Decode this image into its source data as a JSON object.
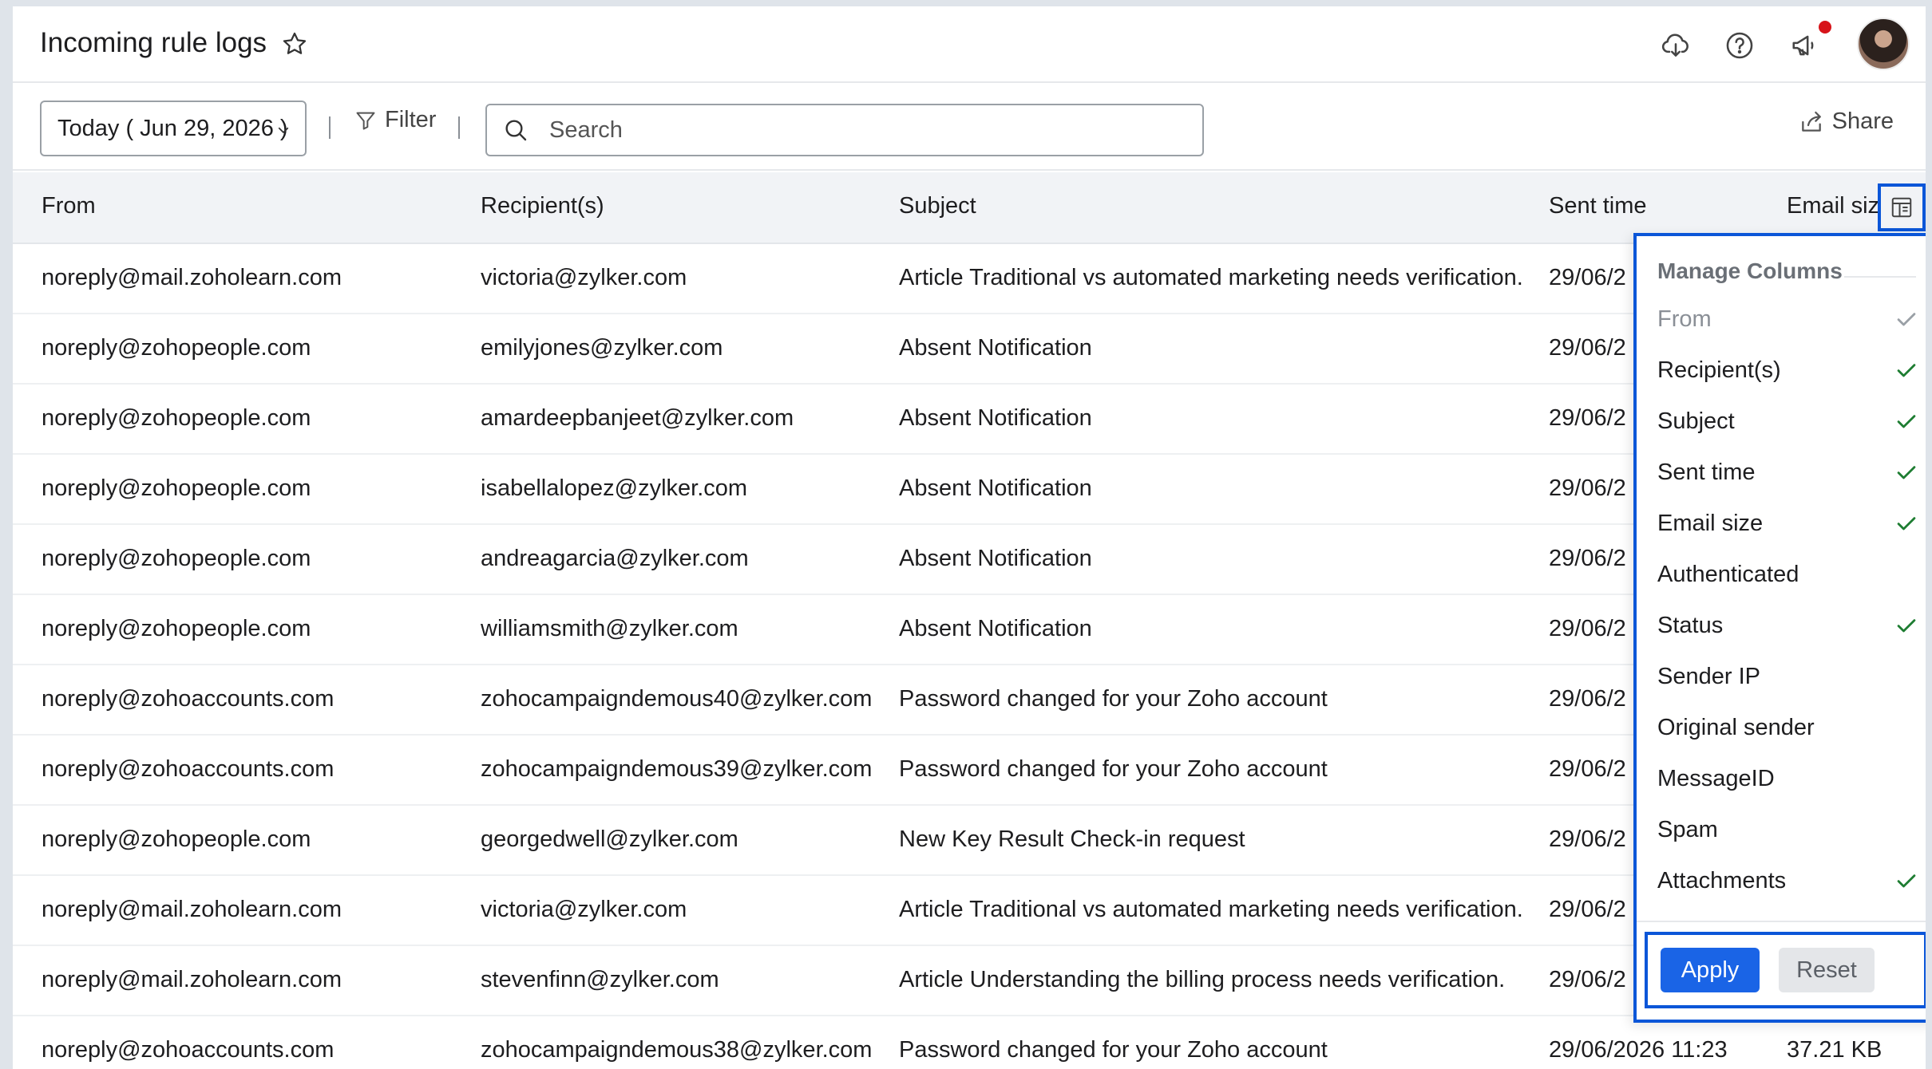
{
  "header": {
    "title": "Incoming rule logs",
    "icons": [
      "star-icon",
      "cloud-download-icon",
      "help-icon",
      "announcement-icon",
      "avatar"
    ]
  },
  "toolbar": {
    "date_label": "Today ( Jun 29, 2026 )",
    "filter_label": "Filter",
    "search_placeholder": "Search",
    "share_label": "Share"
  },
  "table": {
    "columns": [
      "From",
      "Recipient(s)",
      "Subject",
      "Sent time",
      "Email size"
    ],
    "rows": [
      {
        "from": "noreply@mail.zoholearn.com",
        "to": "victoria@zylker.com",
        "subject": "Article Traditional vs automated marketing needs verification.",
        "sent": "29/06/2",
        "size": ""
      },
      {
        "from": "noreply@zohopeople.com",
        "to": "emilyjones@zylker.com",
        "subject": "Absent Notification",
        "sent": "29/06/2",
        "size": ""
      },
      {
        "from": "noreply@zohopeople.com",
        "to": "amardeepbanjeet@zylker.com",
        "subject": "Absent Notification",
        "sent": "29/06/2",
        "size": ""
      },
      {
        "from": "noreply@zohopeople.com",
        "to": "isabellalopez@zylker.com",
        "subject": "Absent Notification",
        "sent": "29/06/2",
        "size": ""
      },
      {
        "from": "noreply@zohopeople.com",
        "to": "andreagarcia@zylker.com",
        "subject": "Absent Notification",
        "sent": "29/06/2",
        "size": ""
      },
      {
        "from": "noreply@zohopeople.com",
        "to": "williamsmith@zylker.com",
        "subject": "Absent Notification",
        "sent": "29/06/2",
        "size": ""
      },
      {
        "from": "noreply@zohoaccounts.com",
        "to": "zohocampaigndemous40@zylker.com",
        "subject": "Password changed for your Zoho account",
        "sent": "29/06/2",
        "size": ""
      },
      {
        "from": "noreply@zohoaccounts.com",
        "to": "zohocampaigndemous39@zylker.com",
        "subject": "Password changed for your Zoho account",
        "sent": "29/06/2",
        "size": ""
      },
      {
        "from": "noreply@zohopeople.com",
        "to": "georgedwell@zylker.com",
        "subject": "New Key Result Check-in request",
        "sent": "29/06/2",
        "size": ""
      },
      {
        "from": "noreply@mail.zoholearn.com",
        "to": "victoria@zylker.com",
        "subject": "Article Traditional vs automated marketing needs verification.",
        "sent": "29/06/2",
        "size": ""
      },
      {
        "from": "noreply@mail.zoholearn.com",
        "to": "stevenfinn@zylker.com",
        "subject": "Article Understanding the billing process needs verification.",
        "sent": "29/06/2",
        "size": ""
      },
      {
        "from": "noreply@zohoaccounts.com",
        "to": "zohocampaigndemous38@zylker.com",
        "subject": "Password changed for your Zoho account",
        "sent": "29/06/2026 11:23",
        "size": "37.21 KB"
      }
    ]
  },
  "manage_columns": {
    "title": "Manage Columns",
    "options": [
      {
        "label": "From",
        "checked": true,
        "disabled": true
      },
      {
        "label": "Recipient(s)",
        "checked": true,
        "disabled": false
      },
      {
        "label": "Subject",
        "checked": true,
        "disabled": false
      },
      {
        "label": "Sent time",
        "checked": true,
        "disabled": false
      },
      {
        "label": "Email size",
        "checked": true,
        "disabled": false
      },
      {
        "label": "Authenticated",
        "checked": false,
        "disabled": false
      },
      {
        "label": "Status",
        "checked": true,
        "disabled": false
      },
      {
        "label": "Sender IP",
        "checked": false,
        "disabled": false
      },
      {
        "label": "Original sender",
        "checked": false,
        "disabled": false
      },
      {
        "label": "MessageID",
        "checked": false,
        "disabled": false
      },
      {
        "label": "Spam",
        "checked": false,
        "disabled": false
      },
      {
        "label": "Attachments",
        "checked": true,
        "disabled": false
      }
    ],
    "apply_label": "Apply",
    "reset_label": "Reset"
  },
  "colors": {
    "accent": "#1a64e6",
    "highlight_border": "#0b56d8",
    "check": "#1e7d32",
    "check_disabled": "#9aa0a6",
    "notification_dot": "#d7141a"
  }
}
